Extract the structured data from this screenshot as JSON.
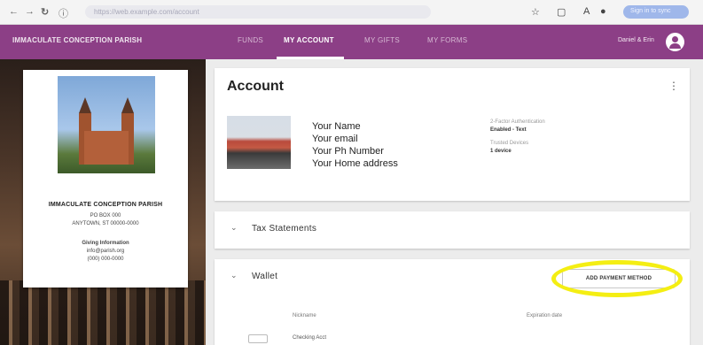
{
  "browser": {
    "url": "https://web.example.com/account",
    "profile_label": "Sign in to sync"
  },
  "app": {
    "brand": "IMMACULATE CONCEPTION PARISH",
    "tabs": [
      {
        "label": "FUNDS",
        "active": false
      },
      {
        "label": "MY ACCOUNT",
        "active": true
      },
      {
        "label": "MY GIFTS",
        "active": false
      },
      {
        "label": "MY FORMS",
        "active": false
      }
    ],
    "user_name": "Daniel & Erin"
  },
  "church": {
    "name": "IMMACULATE CONCEPTION PARISH",
    "po_box": "PO BOX 000",
    "city": "ANYTOWN, ST 00000-0000",
    "giving_label": "Giving Information",
    "email": "info@parish.org",
    "phone": "(000) 000-0000"
  },
  "account": {
    "title": "Account",
    "name": "Your Name",
    "email": "Your email",
    "phone": "Your Ph Number",
    "address": "Your Home address",
    "meta": {
      "auth_label": "2-Factor Authentication",
      "auth_value": "Enabled - Text",
      "devices_label": "Trusted Devices",
      "devices_value": "1 device"
    }
  },
  "tax": {
    "title": "Tax Statements"
  },
  "wallet": {
    "title": "Wallet",
    "add_button": "ADD PAYMENT METHOD",
    "col_nickname": "Nickname",
    "col_expiration": "Expiration date",
    "row_text": "Checking Acct"
  },
  "colors": {
    "brand": "#8c3f86",
    "highlight": "#f4ee13"
  }
}
